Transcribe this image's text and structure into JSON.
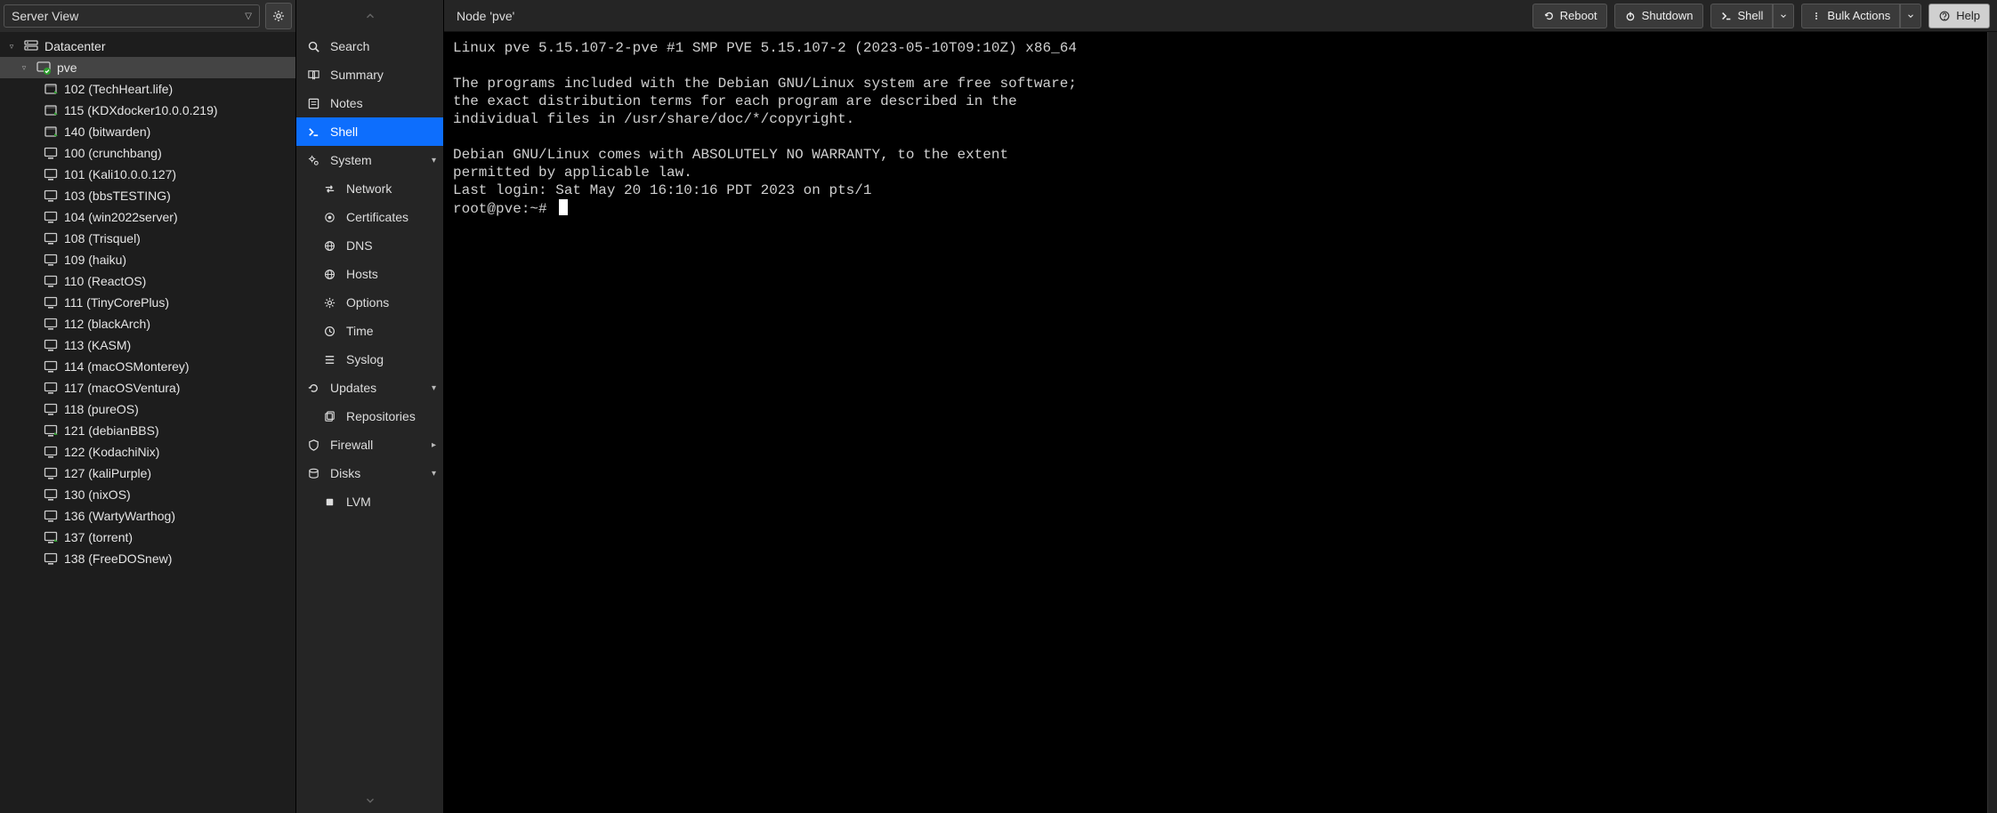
{
  "sidebarHeader": {
    "viewSelector": "Server View"
  },
  "tree": {
    "root": {
      "label": "Datacenter",
      "icon": "server"
    },
    "node": {
      "label": "pve",
      "icon": "node-ok"
    },
    "vms": [
      {
        "label": "102 (TechHeart.life)",
        "icon": "ct-run"
      },
      {
        "label": "115 (KDXdocker10.0.0.219)",
        "icon": "ct-run"
      },
      {
        "label": "140 (bitwarden)",
        "icon": "ct-run"
      },
      {
        "label": "100 (crunchbang)",
        "icon": "vm-stop"
      },
      {
        "label": "101 (Kali10.0.0.127)",
        "icon": "vm-stop"
      },
      {
        "label": "103 (bbsTESTING)",
        "icon": "vm-stop"
      },
      {
        "label": "104 (win2022server)",
        "icon": "vm-stop"
      },
      {
        "label": "108 (Trisquel)",
        "icon": "vm-stop"
      },
      {
        "label": "109 (haiku)",
        "icon": "vm-stop"
      },
      {
        "label": "110 (ReactOS)",
        "icon": "vm-stop"
      },
      {
        "label": "111 (TinyCorePlus)",
        "icon": "vm-stop"
      },
      {
        "label": "112 (blackArch)",
        "icon": "vm-stop"
      },
      {
        "label": "113 (KASM)",
        "icon": "vm-stop"
      },
      {
        "label": "114 (macOSMonterey)",
        "icon": "vm-stop"
      },
      {
        "label": "117 (macOSVentura)",
        "icon": "vm-stop"
      },
      {
        "label": "118 (pureOS)",
        "icon": "vm-stop"
      },
      {
        "label": "121 (debianBBS)",
        "icon": "vm-run"
      },
      {
        "label": "122 (KodachiNix)",
        "icon": "vm-stop"
      },
      {
        "label": "127 (kaliPurple)",
        "icon": "vm-stop"
      },
      {
        "label": "130 (nixOS)",
        "icon": "vm-stop"
      },
      {
        "label": "136 (WartyWarthog)",
        "icon": "vm-stop"
      },
      {
        "label": "137 (torrent)",
        "icon": "vm-run"
      },
      {
        "label": "138 (FreeDOSnew)",
        "icon": "vm-stop"
      }
    ]
  },
  "menu": [
    {
      "label": "Search",
      "icon": "search"
    },
    {
      "label": "Summary",
      "icon": "book"
    },
    {
      "label": "Notes",
      "icon": "note"
    },
    {
      "label": "Shell",
      "icon": "shell",
      "active": true
    },
    {
      "label": "System",
      "icon": "gears",
      "caret": "down"
    },
    {
      "label": "Network",
      "icon": "swap",
      "sub": true
    },
    {
      "label": "Certificates",
      "icon": "cert",
      "sub": true
    },
    {
      "label": "DNS",
      "icon": "globe",
      "sub": true
    },
    {
      "label": "Hosts",
      "icon": "globe",
      "sub": true
    },
    {
      "label": "Options",
      "icon": "gear",
      "sub": true
    },
    {
      "label": "Time",
      "icon": "clock",
      "sub": true
    },
    {
      "label": "Syslog",
      "icon": "list",
      "sub": true
    },
    {
      "label": "Updates",
      "icon": "refresh",
      "caret": "down"
    },
    {
      "label": "Repositories",
      "icon": "files",
      "sub": true
    },
    {
      "label": "Firewall",
      "icon": "shield",
      "caret": "right"
    },
    {
      "label": "Disks",
      "icon": "disk",
      "caret": "down"
    },
    {
      "label": "LVM",
      "icon": "square",
      "sub": true
    }
  ],
  "header": {
    "title": "Node 'pve'",
    "buttons": {
      "reboot": "Reboot",
      "shutdown": "Shutdown",
      "shell": "Shell",
      "bulk": "Bulk Actions",
      "help": "Help"
    }
  },
  "terminal": {
    "lines": [
      "Linux pve 5.15.107-2-pve #1 SMP PVE 5.15.107-2 (2023-05-10T09:10Z) x86_64",
      "",
      "The programs included with the Debian GNU/Linux system are free software;",
      "the exact distribution terms for each program are described in the",
      "individual files in /usr/share/doc/*/copyright.",
      "",
      "Debian GNU/Linux comes with ABSOLUTELY NO WARRANTY, to the extent",
      "permitted by applicable law.",
      "Last login: Sat May 20 16:10:16 PDT 2023 on pts/1"
    ],
    "prompt": "root@pve:~#"
  }
}
